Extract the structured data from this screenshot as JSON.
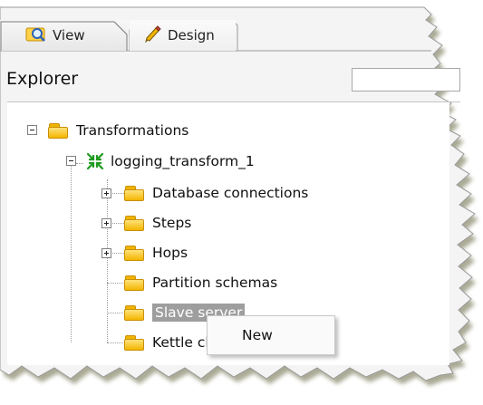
{
  "tabs": [
    {
      "label": "View",
      "icon": "view-icon"
    },
    {
      "label": "Design",
      "icon": "pencil-icon"
    }
  ],
  "explorer": {
    "title": "Explorer",
    "search_value": ""
  },
  "tree": {
    "root": "Transformations",
    "transform": "logging_transform_1",
    "children": [
      "Database connections",
      "Steps",
      "Hops",
      "Partition schemas",
      "Slave server",
      "Kettle cluster schemas"
    ]
  },
  "context_menu": {
    "items": [
      "New"
    ]
  },
  "colors": {
    "folder": "#f3b600",
    "selection": "#9e9e9e",
    "torn_edge_shadow": "#9b9b86"
  }
}
